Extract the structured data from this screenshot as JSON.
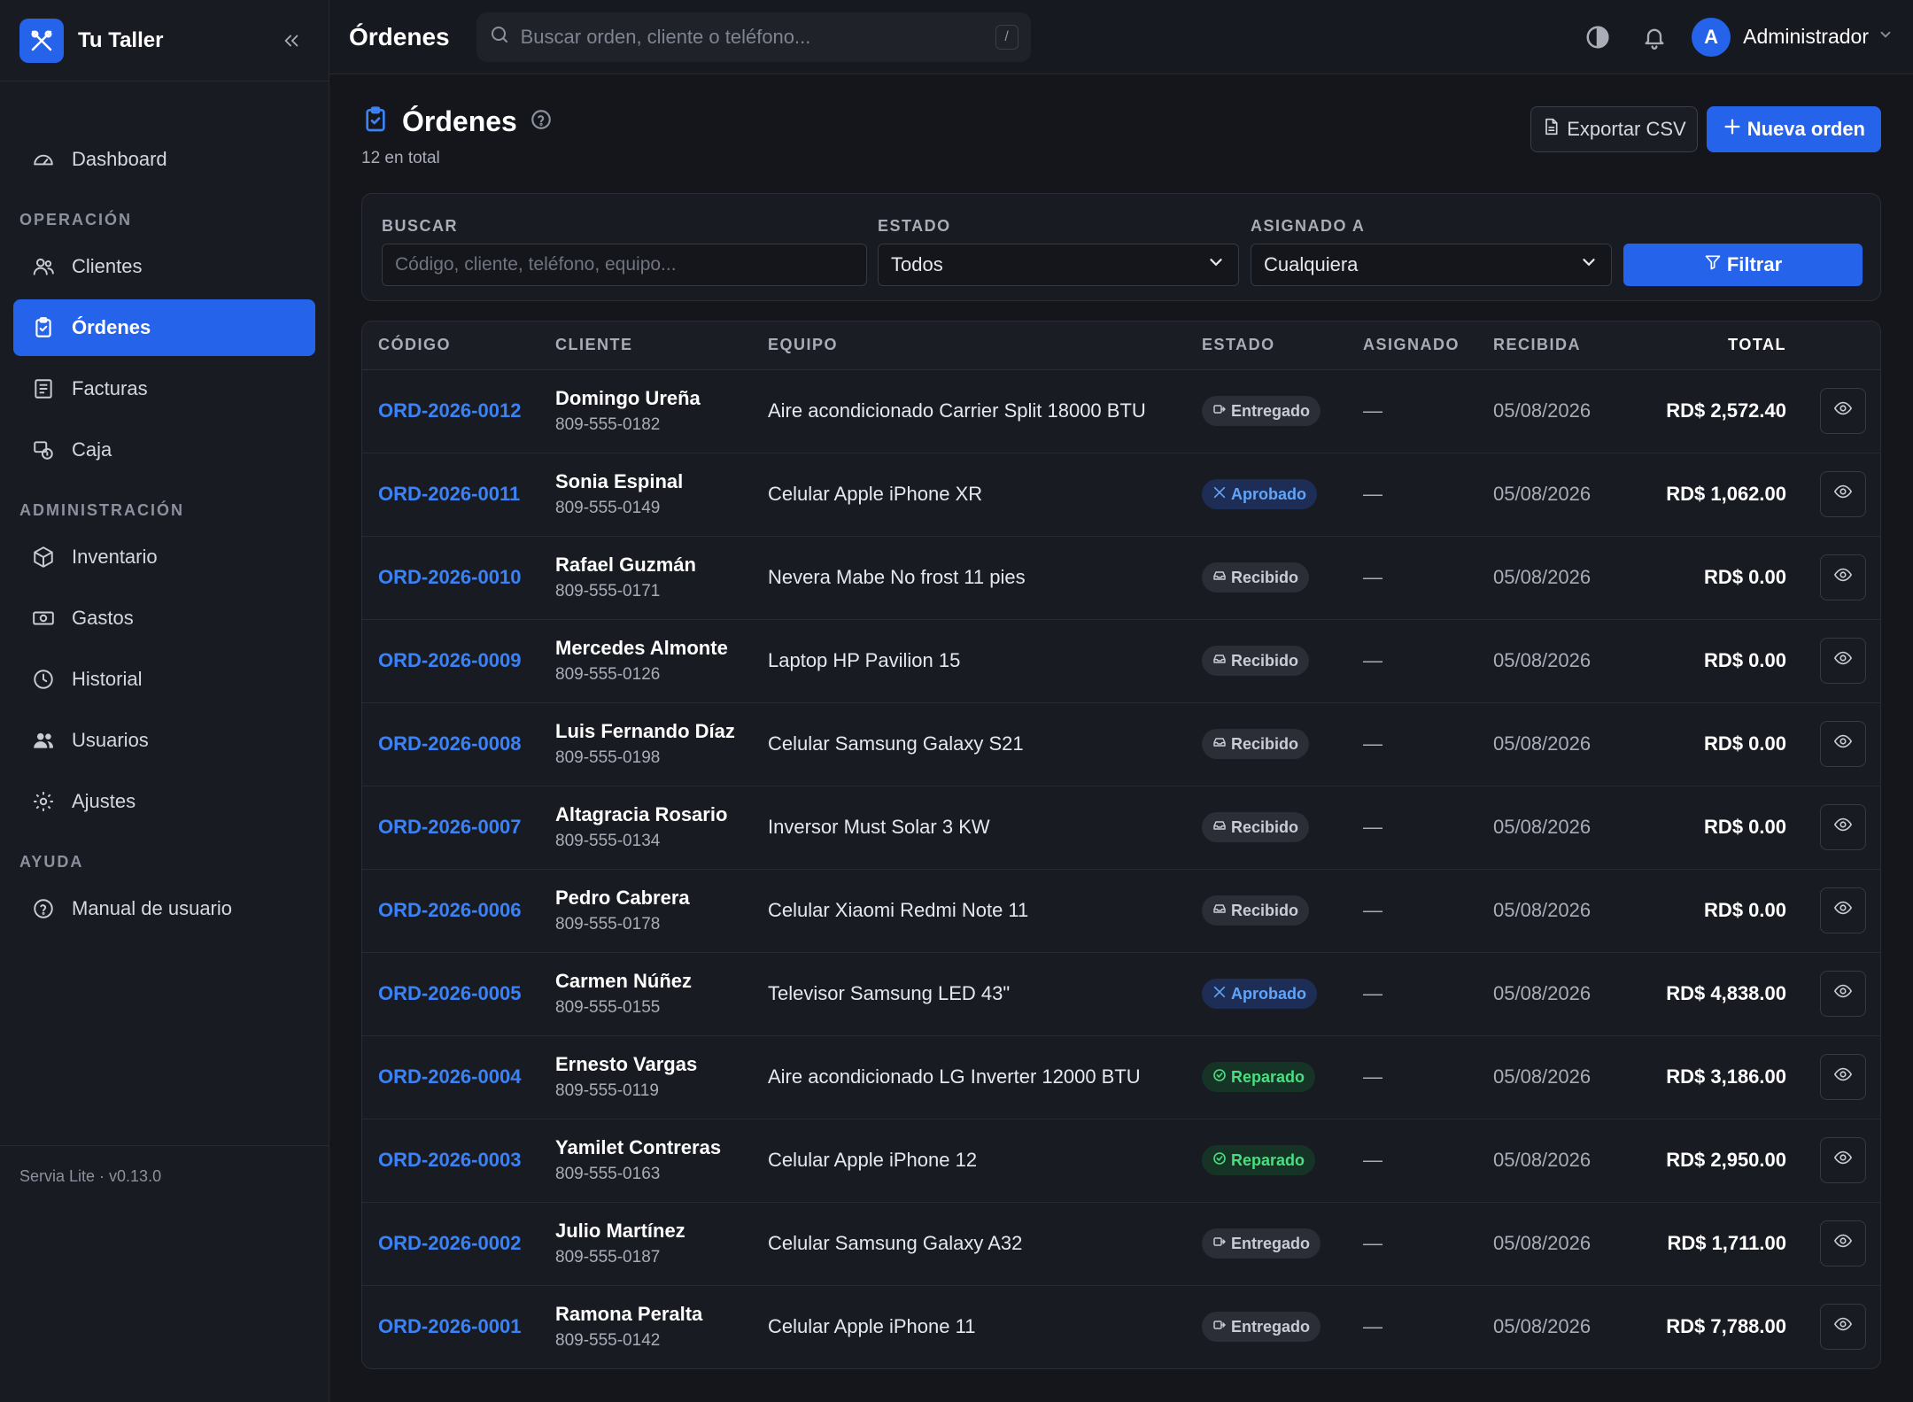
{
  "app": {
    "name": "Tu Taller",
    "version": "Servia Lite · v0.13.0"
  },
  "colors": {
    "accent": "#2563eb",
    "link": "#3b82f6",
    "success": "#4ade80",
    "background": "#14161c"
  },
  "sidebar": {
    "top": [
      {
        "label": "Dashboard",
        "icon": "gauge-icon"
      }
    ],
    "sections": [
      {
        "title": "OPERACIÓN",
        "items": [
          {
            "label": "Clientes",
            "icon": "users-icon"
          },
          {
            "label": "Órdenes",
            "icon": "clipboard-icon",
            "active": true
          },
          {
            "label": "Facturas",
            "icon": "receipt-icon"
          },
          {
            "label": "Caja",
            "icon": "cash-register-icon"
          }
        ]
      },
      {
        "title": "ADMINISTRACIÓN",
        "items": [
          {
            "label": "Inventario",
            "icon": "box-icon"
          },
          {
            "label": "Gastos",
            "icon": "banknote-icon"
          },
          {
            "label": "Historial",
            "icon": "clock-icon"
          },
          {
            "label": "Usuarios",
            "icon": "user-group-icon"
          },
          {
            "label": "Ajustes",
            "icon": "gear-icon"
          }
        ]
      },
      {
        "title": "AYUDA",
        "items": [
          {
            "label": "Manual de usuario",
            "icon": "help-circle-icon"
          }
        ]
      }
    ]
  },
  "topbar": {
    "title": "Órdenes",
    "search_placeholder": "Buscar orden, cliente o teléfono...",
    "shortcut": "/",
    "user": {
      "initial": "A",
      "name": "Administrador"
    }
  },
  "page": {
    "title": "Órdenes",
    "subtitle": "12 en total",
    "export_label": "Exportar CSV",
    "new_label": "Nueva orden"
  },
  "filters": {
    "search_label": "BUSCAR",
    "search_placeholder": "Código, cliente, teléfono, equipo...",
    "status_label": "ESTADO",
    "status_value": "Todos",
    "assigned_label": "ASIGNADO A",
    "assigned_value": "Cualquiera",
    "button_label": "Filtrar"
  },
  "table": {
    "columns": [
      "CÓDIGO",
      "CLIENTE",
      "EQUIPO",
      "ESTADO",
      "ASIGNADO",
      "RECIBIDA",
      "TOTAL"
    ],
    "rows": [
      {
        "code": "ORD-2026-0012",
        "client": "Domingo Ureña",
        "phone": "809-555-0182",
        "equipment": "Aire acondicionado Carrier Split 18000 BTU",
        "status": "Entregado",
        "assigned": "—",
        "received": "05/08/2026",
        "total": "RD$ 2,572.40"
      },
      {
        "code": "ORD-2026-0011",
        "client": "Sonia Espinal",
        "phone": "809-555-0149",
        "equipment": "Celular Apple iPhone XR",
        "status": "Aprobado",
        "assigned": "—",
        "received": "05/08/2026",
        "total": "RD$ 1,062.00"
      },
      {
        "code": "ORD-2026-0010",
        "client": "Rafael Guzmán",
        "phone": "809-555-0171",
        "equipment": "Nevera Mabe No frost 11 pies",
        "status": "Recibido",
        "assigned": "—",
        "received": "05/08/2026",
        "total": "RD$ 0.00"
      },
      {
        "code": "ORD-2026-0009",
        "client": "Mercedes Almonte",
        "phone": "809-555-0126",
        "equipment": "Laptop HP Pavilion 15",
        "status": "Recibido",
        "assigned": "—",
        "received": "05/08/2026",
        "total": "RD$ 0.00"
      },
      {
        "code": "ORD-2026-0008",
        "client": "Luis Fernando Díaz",
        "phone": "809-555-0198",
        "equipment": "Celular Samsung Galaxy S21",
        "status": "Recibido",
        "assigned": "—",
        "received": "05/08/2026",
        "total": "RD$ 0.00"
      },
      {
        "code": "ORD-2026-0007",
        "client": "Altagracia Rosario",
        "phone": "809-555-0134",
        "equipment": "Inversor Must Solar 3 KW",
        "status": "Recibido",
        "assigned": "—",
        "received": "05/08/2026",
        "total": "RD$ 0.00"
      },
      {
        "code": "ORD-2026-0006",
        "client": "Pedro Cabrera",
        "phone": "809-555-0178",
        "equipment": "Celular Xiaomi Redmi Note 11",
        "status": "Recibido",
        "assigned": "—",
        "received": "05/08/2026",
        "total": "RD$ 0.00"
      },
      {
        "code": "ORD-2026-0005",
        "client": "Carmen Núñez",
        "phone": "809-555-0155",
        "equipment": "Televisor Samsung LED 43\"",
        "status": "Aprobado",
        "assigned": "—",
        "received": "05/08/2026",
        "total": "RD$ 4,838.00"
      },
      {
        "code": "ORD-2026-0004",
        "client": "Ernesto Vargas",
        "phone": "809-555-0119",
        "equipment": "Aire acondicionado LG Inverter 12000 BTU",
        "status": "Reparado",
        "assigned": "—",
        "received": "05/08/2026",
        "total": "RD$ 3,186.00"
      },
      {
        "code": "ORD-2026-0003",
        "client": "Yamilet Contreras",
        "phone": "809-555-0163",
        "equipment": "Celular Apple iPhone 12",
        "status": "Reparado",
        "assigned": "—",
        "received": "05/08/2026",
        "total": "RD$ 2,950.00"
      },
      {
        "code": "ORD-2026-0002",
        "client": "Julio Martínez",
        "phone": "809-555-0187",
        "equipment": "Celular Samsung Galaxy A32",
        "status": "Entregado",
        "assigned": "—",
        "received": "05/08/2026",
        "total": "RD$ 1,711.00"
      },
      {
        "code": "ORD-2026-0001",
        "client": "Ramona Peralta",
        "phone": "809-555-0142",
        "equipment": "Celular Apple iPhone 11",
        "status": "Entregado",
        "assigned": "—",
        "received": "05/08/2026",
        "total": "RD$ 7,788.00"
      }
    ]
  }
}
